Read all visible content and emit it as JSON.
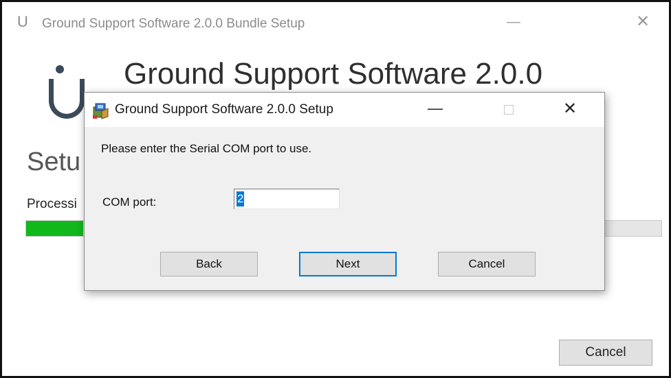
{
  "main_window": {
    "title": "Ground Support Software 2.0.0 Bundle Setup",
    "logo_glyph": "U",
    "minimize_glyph": "—",
    "close_glyph": "✕",
    "product_title": "Ground Support Software 2.0.0",
    "setup_heading": "Setu",
    "processing_label": "Processi",
    "progress_fraction": 0.09,
    "progress_color": "#11b81b",
    "cancel_label": "Cancel"
  },
  "dialog": {
    "title": "Ground Support Software 2.0.0 Setup",
    "icon": "installer-package-icon",
    "minimize_glyph": "—",
    "close_glyph": "✕",
    "message": "Please enter the Serial COM port to use.",
    "com_port_label": "COM port:",
    "com_port_value": "2",
    "back_label": "Back",
    "next_label": "Next",
    "cancel_label": "Cancel",
    "focus_color": "#0078d7"
  }
}
